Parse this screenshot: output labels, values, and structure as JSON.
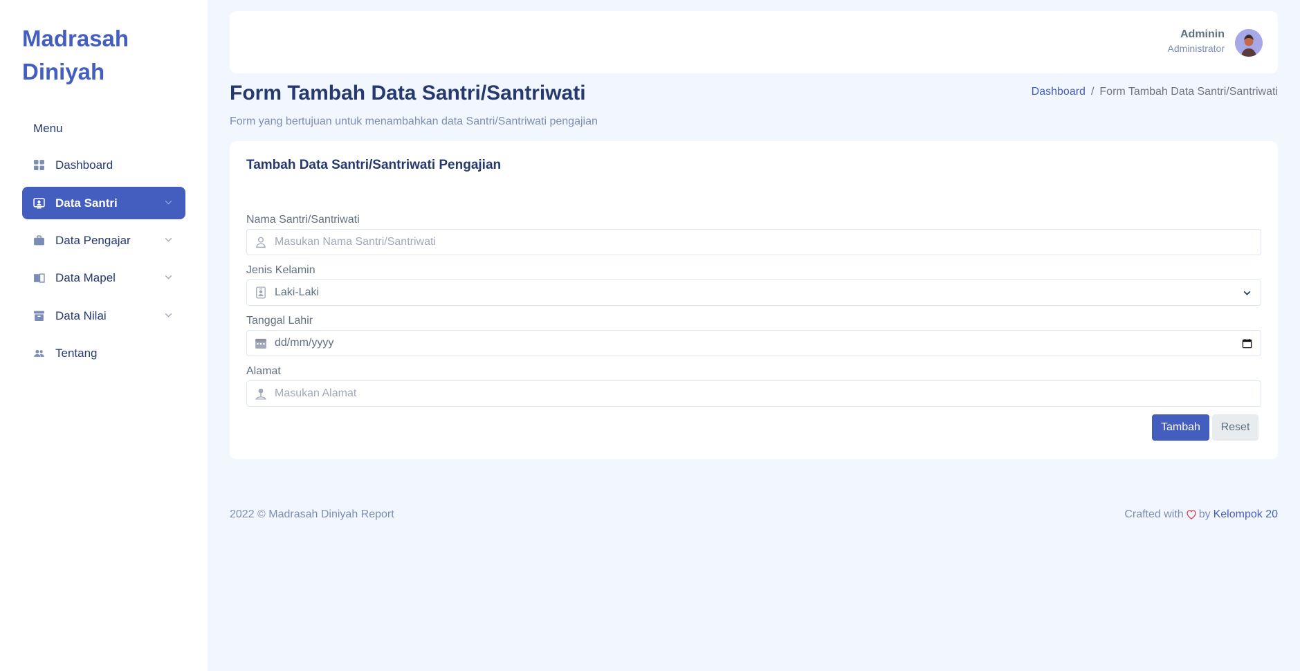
{
  "sidebar": {
    "logo": "Madrasah Diniyah",
    "menu_title": "Menu",
    "items": [
      {
        "label": "Dashboard",
        "icon": "grid-icon"
      },
      {
        "label": "Data Santri",
        "icon": "person-badge-icon",
        "active": true,
        "has_submenu": true
      },
      {
        "label": "Data Pengajar",
        "icon": "briefcase-icon",
        "has_submenu": true
      },
      {
        "label": "Data Mapel",
        "icon": "book-icon",
        "has_submenu": true
      },
      {
        "label": "Data Nilai",
        "icon": "archive-icon",
        "has_submenu": true
      },
      {
        "label": "Tentang",
        "icon": "people-icon"
      }
    ]
  },
  "header": {
    "user_name": "Adminin",
    "user_role": "Administrator"
  },
  "page": {
    "title": "Form Tambah Data Santri/Santriwati",
    "subtitle": "Form yang bertujuan untuk menambahkan data Santri/Santriwati pengajian",
    "breadcrumb": [
      "Dashboard",
      "Form Tambah Data Santri/Santriwati"
    ]
  },
  "form": {
    "card_title": "Tambah Data Santri/Santriwati Pengajian",
    "fields": {
      "nama": {
        "label": "Nama Santri/Santriwati",
        "placeholder": "Masukan Nama Santri/Santriwati"
      },
      "jenis_kelamin": {
        "label": "Jenis Kelamin",
        "value": "Laki-Laki"
      },
      "tanggal_lahir": {
        "label": "Tanggal Lahir",
        "value": "dd/mm/yyyy"
      },
      "alamat": {
        "label": "Alamat",
        "placeholder": "Masukan Alamat"
      }
    },
    "submit_label": "Tambah",
    "reset_label": "Reset"
  },
  "footer": {
    "copyright": "2022 © Madrasah Diniyah Report",
    "crafted_prefix": "Crafted with",
    "crafted_by": "by",
    "team": "Kelompok 20"
  },
  "colors": {
    "primary": "#435ebe",
    "background": "#f2f7ff",
    "text_dark": "#25396f",
    "heart": "#dc3545"
  }
}
